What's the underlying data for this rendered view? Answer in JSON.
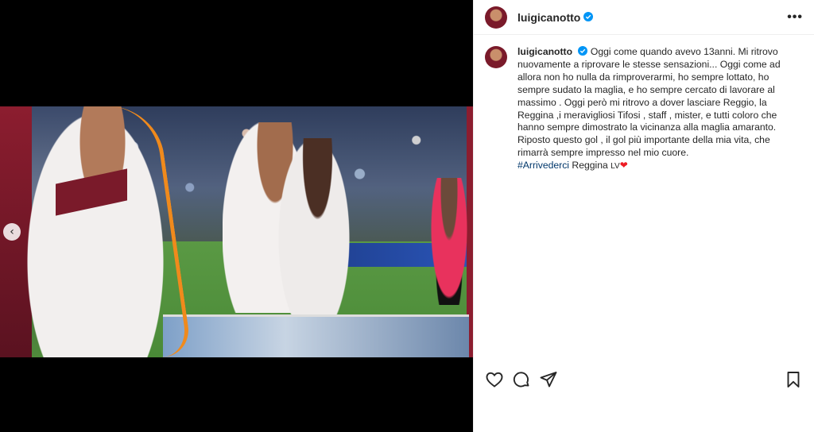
{
  "post": {
    "username": "luigicanotto",
    "more_label": "•••",
    "carousel_prev_label": "‹"
  },
  "caption": {
    "username": "luigicanotto",
    "text": "Oggi come quando avevo 13anni. Mi ritrovo nuovamente a riprovare le stesse sensazioni... Oggi come ad allora non ho nulla da rimproverarmi, ho sempre lottato, ho sempre sudato la maglia, e ho sempre cercato di lavorare al massimo . Oggi però mi ritrovo a dover lasciare Reggio, la Reggina ,i meravigliosi Tifosi , staff , mister, e tutti coloro che hanno sempre dimostrato la vicinanza alla maglia amaranto. Riposto questo gol , il gol più importante della mia vita, che rimarrà sempre impresso nel mio cuore.",
    "hashtag": "#Arrivederci",
    "after_hashtag": " Reggina ",
    "lv": "LV",
    "heart": "❤"
  },
  "icons": {
    "verified": "verified-badge-icon",
    "like": "heart-outline-icon",
    "comment": "comment-icon",
    "share": "paper-plane-icon",
    "save": "bookmark-icon"
  },
  "colors": {
    "verified": "#0095f6",
    "hashtag": "#00376b",
    "heart": "#ed1c24",
    "club_maroon": "#7a1a2a"
  }
}
